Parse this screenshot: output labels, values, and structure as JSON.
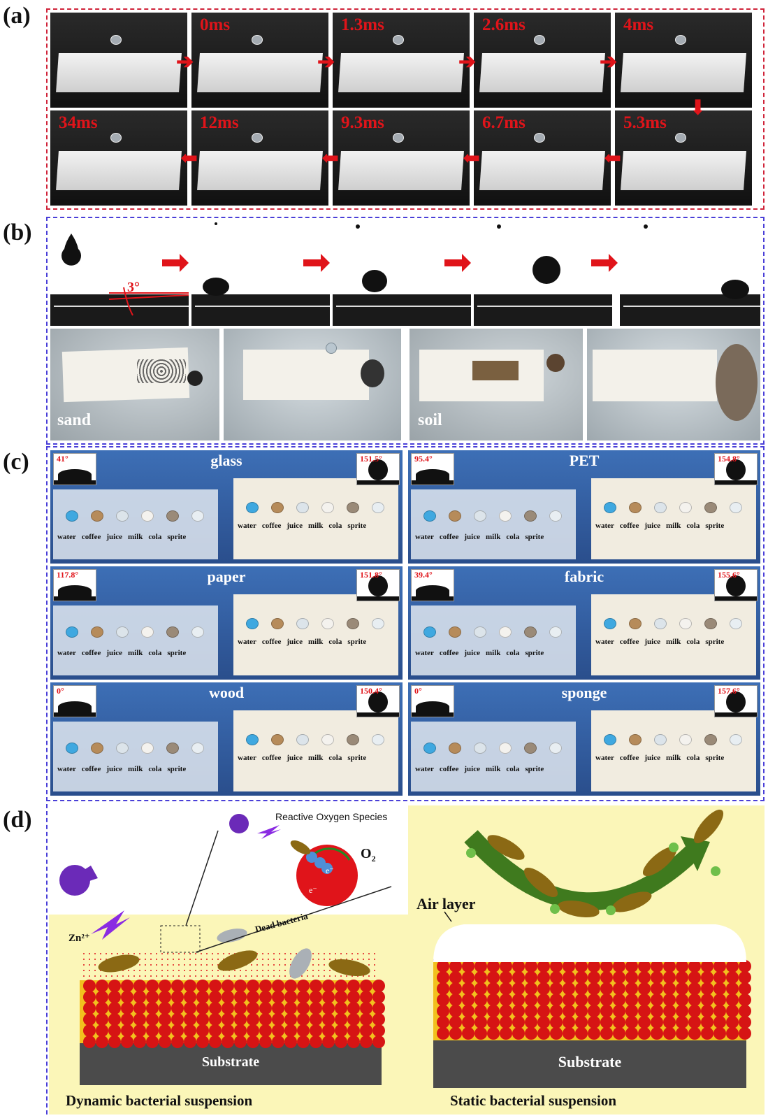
{
  "panel_labels": {
    "a": "(a)",
    "b": "(b)",
    "c": "(c)",
    "d": "(d)"
  },
  "panel_a": {
    "row1": [
      "",
      "0ms",
      "1.3ms",
      "2.6ms",
      "4ms"
    ],
    "row2": [
      "34ms",
      "12ms",
      "9.3ms",
      "6.7ms",
      "5.3ms"
    ]
  },
  "panel_b": {
    "tilt_angle": "3°",
    "sand_label": "sand",
    "soil_label": "soil"
  },
  "panel_c": {
    "materials": [
      {
        "name": "glass",
        "ca_left": "41°",
        "ca_right": "151.5°",
        "liquids_left": [
          "water",
          "coffee",
          "juice",
          "milk",
          "cola",
          "sprite"
        ],
        "liquids_right": [
          "water",
          "coffee",
          "juice",
          "milk",
          "cola",
          "sprite"
        ]
      },
      {
        "name": "PET",
        "ca_left": "95.4°",
        "ca_right": "154.8°",
        "liquids_left": [
          "water",
          "coffee",
          "juice",
          "milk",
          "cola",
          "sprite"
        ],
        "liquids_right": [
          "water",
          "coffee",
          "juice",
          "milk",
          "cola",
          "sprite"
        ]
      },
      {
        "name": "paper",
        "ca_left": "117.8°",
        "ca_right": "151.8°",
        "liquids_left": [
          "water",
          "coffee",
          "juice",
          "milk",
          "cola",
          "sprite"
        ],
        "liquids_right": [
          "water",
          "coffee",
          "juice",
          "milk",
          "cola",
          "sprite"
        ]
      },
      {
        "name": "fabric",
        "ca_left": "39.4°",
        "ca_right": "155.6°",
        "liquids_left": [
          "water",
          "coffee",
          "juice",
          "milk",
          "cola",
          "sprite"
        ],
        "liquids_right": [
          "water",
          "coffee",
          "juice",
          "milk",
          "cola",
          "sprite"
        ]
      },
      {
        "name": "wood",
        "ca_left": "0°",
        "ca_right": "150.4°",
        "liquids_left": [
          "water",
          "coffee",
          "juice",
          "milk",
          "cola",
          "sprite"
        ],
        "liquids_right": [
          "water",
          "coffee",
          "juice",
          "milk",
          "cola",
          "sprite"
        ]
      },
      {
        "name": "sponge",
        "ca_left": "0°",
        "ca_right": "157.6°",
        "liquids_left": [
          "water",
          "coffee",
          "juice",
          "milk",
          "cola",
          "sprite"
        ],
        "liquids_right": [
          "water",
          "coffee",
          "juice",
          "milk",
          "cola",
          "sprite"
        ]
      }
    ]
  },
  "panel_d": {
    "ros": "Reactive Oxygen Species",
    "o2": "O",
    "o2_sub": "2",
    "electron": "e⁻",
    "zn": "Zn²⁺",
    "dead_bacteria": "Dead bacteria",
    "air_layer": "Air layer",
    "substrate_left": "Substrate",
    "substrate_right": "Substrate",
    "caption_left": "Dynamic bacterial suspension",
    "caption_right": "Static bacterial suspension"
  }
}
